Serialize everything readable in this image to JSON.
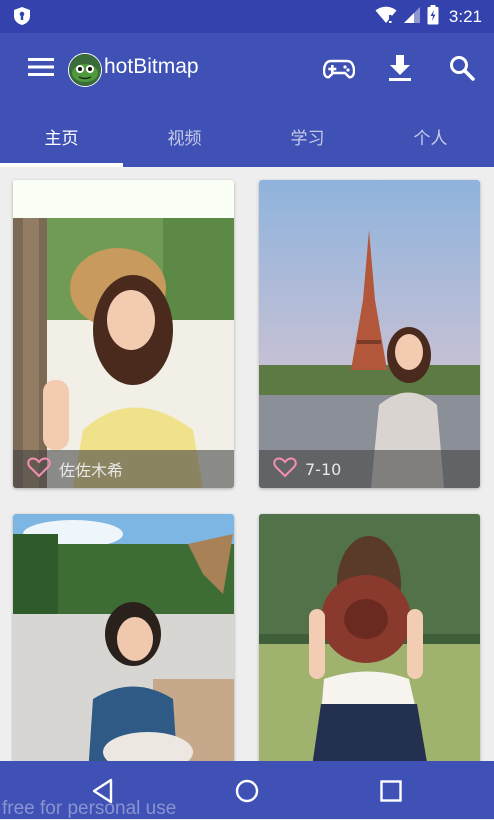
{
  "status_bar": {
    "time": "3:21"
  },
  "toolbar": {
    "title": "hotBitmap",
    "icons": [
      "menu-icon",
      "avatar",
      "gamepad-icon",
      "download-icon",
      "search-icon"
    ]
  },
  "tabs": [
    {
      "label": "主页",
      "active": true
    },
    {
      "label": "视频",
      "active": false
    },
    {
      "label": "学习",
      "active": false
    },
    {
      "label": "个人",
      "active": false
    }
  ],
  "cards": [
    {
      "label": "佐佐木希",
      "icon": "heart-outline-icon"
    },
    {
      "label": "7-10",
      "icon": "heart-outline-icon"
    },
    {
      "label": "",
      "icon": ""
    },
    {
      "label": "",
      "icon": ""
    }
  ],
  "nav": {
    "icons": [
      "back-triangle-icon",
      "home-circle-icon",
      "recents-square-icon"
    ]
  },
  "watermark": "free for personal use",
  "colors": {
    "primary": "#3f51b5",
    "status_bar": "#3342ad",
    "accent_heart": "#f48fb1",
    "background": "#eeeeee"
  }
}
